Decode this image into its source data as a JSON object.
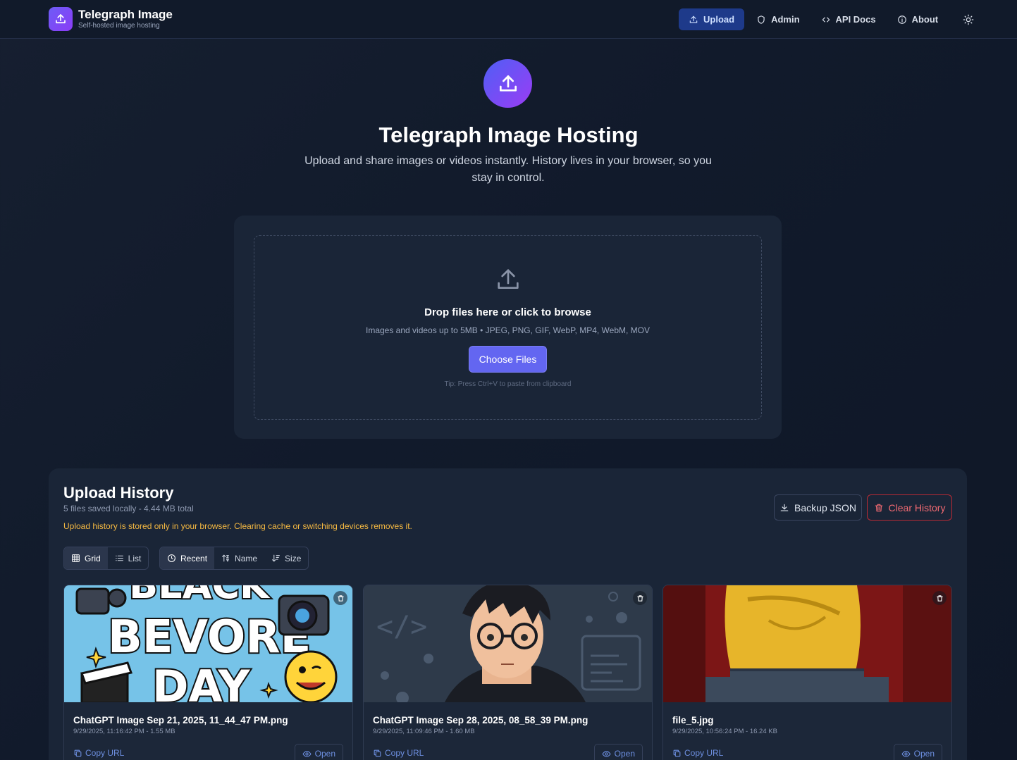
{
  "header": {
    "brand_title": "Telegraph Image",
    "brand_subtitle": "Self-hosted image hosting",
    "nav": [
      {
        "label": "Upload",
        "icon": "upload-icon",
        "active": true
      },
      {
        "label": "Admin",
        "icon": "shield-icon",
        "active": false
      },
      {
        "label": "API Docs",
        "icon": "code-icon",
        "active": false
      },
      {
        "label": "About",
        "icon": "info-icon",
        "active": false
      }
    ],
    "theme_toggle_icon": "sun-icon"
  },
  "hero": {
    "title": "Telegraph Image Hosting",
    "subtitle": "Upload and share images or videos instantly. History lives in your browser, so you stay in control."
  },
  "upload": {
    "title": "Drop files here or click to browse",
    "description": "Images and videos up to 5MB • JPEG, PNG, GIF, WebP, MP4, WebM, MOV",
    "button": "Choose Files",
    "tip": "Tip: Press Ctrl+V to paste from clipboard"
  },
  "history": {
    "title": "Upload History",
    "meta": "5 files saved locally - 4.44 MB total",
    "warning": "Upload history is stored only in your browser. Clearing cache or switching devices removes it.",
    "backup_label": "Backup JSON",
    "clear_label": "Clear History",
    "view_options": [
      "Grid",
      "List"
    ],
    "active_view": "Grid",
    "sort_options": [
      "Recent",
      "Name",
      "Size"
    ],
    "active_sort": "Recent",
    "copy_label": "Copy URL",
    "open_label": "Open",
    "items": [
      {
        "name": "ChatGPT Image Sep 21, 2025, 11_44_47 PM.png",
        "meta": "9/29/2025, 11:16:42 PM - 1.55 MB"
      },
      {
        "name": "ChatGPT Image Sep 28, 2025, 08_58_39 PM.png",
        "meta": "9/29/2025, 11:09:46 PM - 1.60 MB"
      },
      {
        "name": "file_5.jpg",
        "meta": "9/29/2025, 10:56:24 PM - 16.24 KB"
      }
    ]
  },
  "colors": {
    "accent": "#6366f1",
    "nav_active_bg": "#1e3a8a",
    "danger": "#b92b35",
    "warning": "#f5b942",
    "link": "#6d8fe0"
  }
}
